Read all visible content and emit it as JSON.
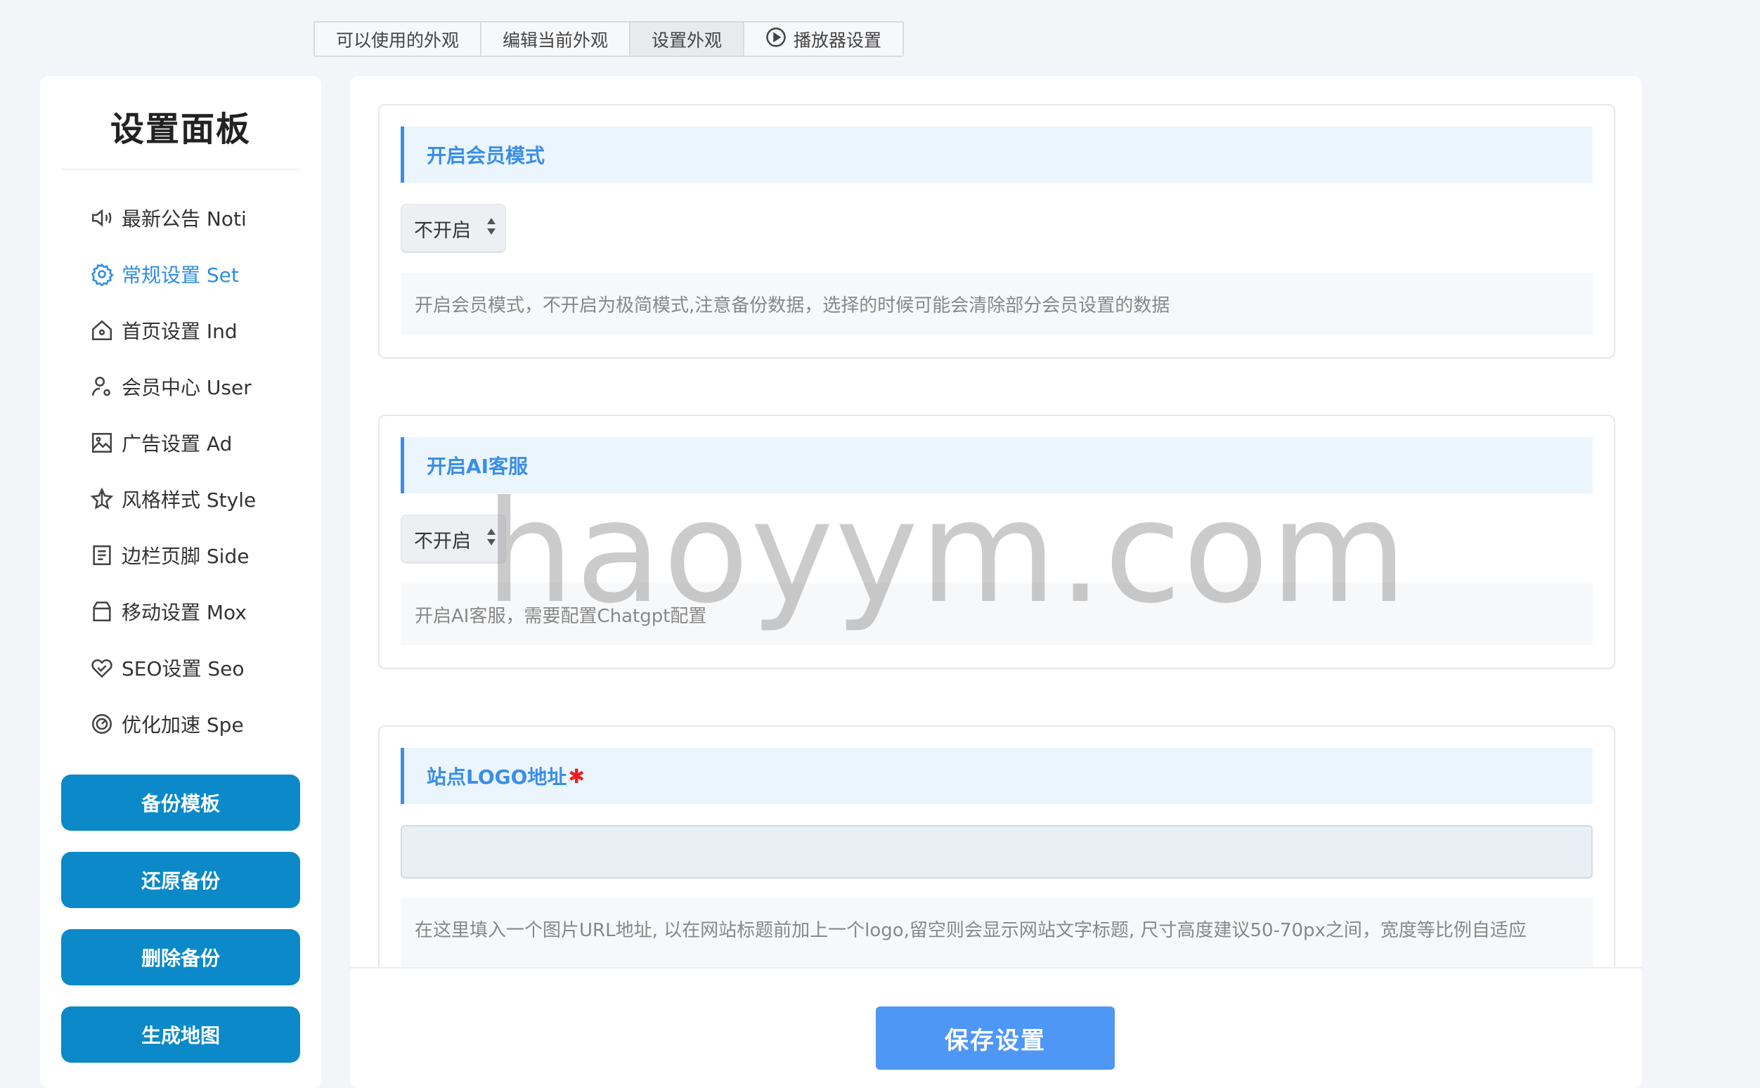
{
  "topnav": {
    "tabs": [
      {
        "label": "可以使用的外观"
      },
      {
        "label": "编辑当前外观"
      },
      {
        "label": "设置外观"
      },
      {
        "label": "播放器设置",
        "icon": "play-circle-icon"
      }
    ],
    "active_index": 2
  },
  "sidebar": {
    "title": "设置面板",
    "items": [
      {
        "label": "最新公告 Noti",
        "icon": "speaker-icon"
      },
      {
        "label": "常规设置 Set",
        "icon": "gear-icon",
        "active": true
      },
      {
        "label": "首页设置 Ind",
        "icon": "home-icon"
      },
      {
        "label": "会员中心 User",
        "icon": "user-settings-icon"
      },
      {
        "label": "广告设置 Ad",
        "icon": "image-icon"
      },
      {
        "label": "风格样式 Style",
        "icon": "star-icon"
      },
      {
        "label": "边栏页脚 Side",
        "icon": "document-icon"
      },
      {
        "label": "移动设置 Mox",
        "icon": "mobile-icon"
      },
      {
        "label": "SEO设置 Seo",
        "icon": "heart-icon"
      },
      {
        "label": "优化加速 Spe",
        "icon": "speedometer-icon"
      }
    ],
    "buttons": {
      "backup": "备份模板",
      "restore": "还原备份",
      "delete": "删除备份",
      "sitemap": "生成地图"
    }
  },
  "sections": {
    "member_mode": {
      "title": "开启会员模式",
      "select_value": "不开启",
      "description": "开启会员模式，不开启为极简模式,注意备份数据，选择的时候可能会清除部分会员设置的数据"
    },
    "ai_service": {
      "title": "开启AI客服",
      "select_value": "不开启",
      "description": "开启AI客服，需要配置Chatgpt配置"
    },
    "logo_url": {
      "title": "站点LOGO地址",
      "required_mark": "✱",
      "value": "",
      "description": "在这里填入一个图片URL地址, 以在网站标题前加上一个logo,留空则会显示网站文字标题, 尺寸高度建议50-70px之间，宽度等比例自适应"
    }
  },
  "footer": {
    "save_label": "保存设置"
  },
  "watermark": "haoyym.com",
  "colors": {
    "accent": "#3a8ee6",
    "sidebar_button": "#0b89c8",
    "save_button": "#4f97f5",
    "required": "#ee1c1c"
  }
}
